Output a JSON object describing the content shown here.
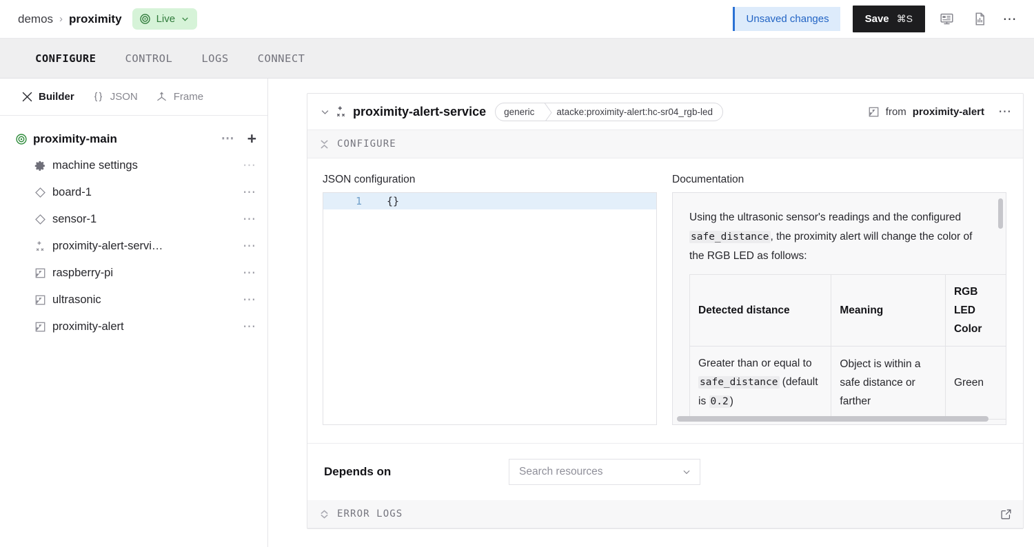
{
  "topbar": {
    "breadcrumb": {
      "root": "demos",
      "separator": "›",
      "current": "proximity"
    },
    "live_badge": {
      "label": "Live",
      "icon": "radar-icon",
      "color": "#2f7a3a",
      "bg": "#d6f3d8"
    },
    "unsaved_label": "Unsaved changes",
    "unsaved_accent": "#2264c4",
    "save_label": "Save",
    "save_shortcut": "⌘S",
    "icons": [
      "monitor-icon",
      "report-file-icon",
      "more-options-icon"
    ]
  },
  "tabs": [
    {
      "label": "CONFIGURE",
      "active": true
    },
    {
      "label": "CONTROL",
      "active": false
    },
    {
      "label": "LOGS",
      "active": false
    },
    {
      "label": "CONNECT",
      "active": false
    }
  ],
  "sidebar": {
    "modes": [
      {
        "label": "Builder",
        "icon": "tools-icon",
        "active": true
      },
      {
        "label": "JSON",
        "icon": "braces-icon",
        "active": false
      },
      {
        "label": "Frame",
        "icon": "frame-axes-icon",
        "active": false
      }
    ],
    "tree": [
      {
        "label": "proximity-main",
        "icon": "radar-icon",
        "level": 0,
        "actions": [
          "more-options",
          "add"
        ]
      },
      {
        "label": "machine settings",
        "icon": "gear-icon",
        "level": 1,
        "actions": [
          "more-options"
        ],
        "muted": true
      },
      {
        "label": "board-1",
        "icon": "diamond-icon",
        "level": 1,
        "actions": [
          "more-options"
        ]
      },
      {
        "label": "sensor-1",
        "icon": "diamond-icon",
        "level": 1,
        "actions": [
          "more-options"
        ]
      },
      {
        "label": "proximity-alert-servi…",
        "icon": "service-sparkle-icon",
        "level": 1,
        "actions": [
          "more-options"
        ]
      },
      {
        "label": "raspberry-pi",
        "icon": "module-icon",
        "level": 1,
        "actions": [
          "more-options"
        ]
      },
      {
        "label": "ultrasonic",
        "icon": "module-icon",
        "level": 1,
        "actions": [
          "more-options"
        ]
      },
      {
        "label": "proximity-alert",
        "icon": "module-icon",
        "level": 1,
        "actions": [
          "more-options"
        ]
      }
    ]
  },
  "card": {
    "title": "proximity-alert-service",
    "pill_type": "generic",
    "pill_model": "atacke:proximity-alert:hc-sr04_rgb-led",
    "from_prefix": "from",
    "from_module": "proximity-alert",
    "section_configure": "CONFIGURE",
    "section_error_logs": "ERROR LOGS",
    "json_label": "JSON configuration",
    "docs_label": "Documentation",
    "editor": {
      "line_number": "1",
      "code": "{}"
    },
    "docs": {
      "paragraph_1a": "Using the ultrasonic sensor's readings and the configured ",
      "paragraph_1b": "safe_distance",
      "paragraph_1c": ", the proximity alert will change the color of the RGB LED as follows:",
      "table": {
        "headers": [
          "Detected distance",
          "Meaning",
          "RGB LED Color"
        ],
        "rows": [
          {
            "distance_pre": "Greater than or equal to ",
            "distance_code": "safe_distance",
            "distance_mid": " (default is ",
            "distance_code2": "0.2",
            "distance_post": ")",
            "meaning": "Object is within a safe distance or farther",
            "color": "Green"
          }
        ]
      }
    },
    "depends_label": "Depends on",
    "depends_placeholder": "Search resources"
  }
}
